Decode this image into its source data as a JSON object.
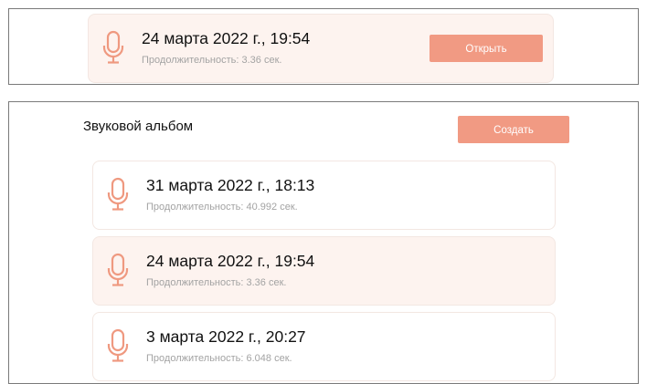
{
  "colors": {
    "accent": "#f19a83",
    "mic_icon": "#ef9980",
    "active_card_bg": "#fdf3ef"
  },
  "selected_record": {
    "title": "24 марта 2022 г., 19:54",
    "duration": "Продолжительность: 3.36 сек.",
    "open_label": "Открыть",
    "icon": "microphone-icon"
  },
  "album": {
    "title": "Звуковой альбом",
    "create_label": "Создать",
    "records": [
      {
        "title": "31 марта 2022 г., 18:13",
        "duration": "Продолжительность: 40.992 сек.",
        "icon": "microphone-icon"
      },
      {
        "title": "24 марта 2022 г., 19:54",
        "duration": "Продолжительность: 3.36 сек.",
        "icon": "microphone-icon",
        "selected": true
      },
      {
        "title": "3 марта 2022 г., 20:27",
        "duration": "Продолжительность: 6.048 сек.",
        "icon": "microphone-icon"
      }
    ]
  }
}
